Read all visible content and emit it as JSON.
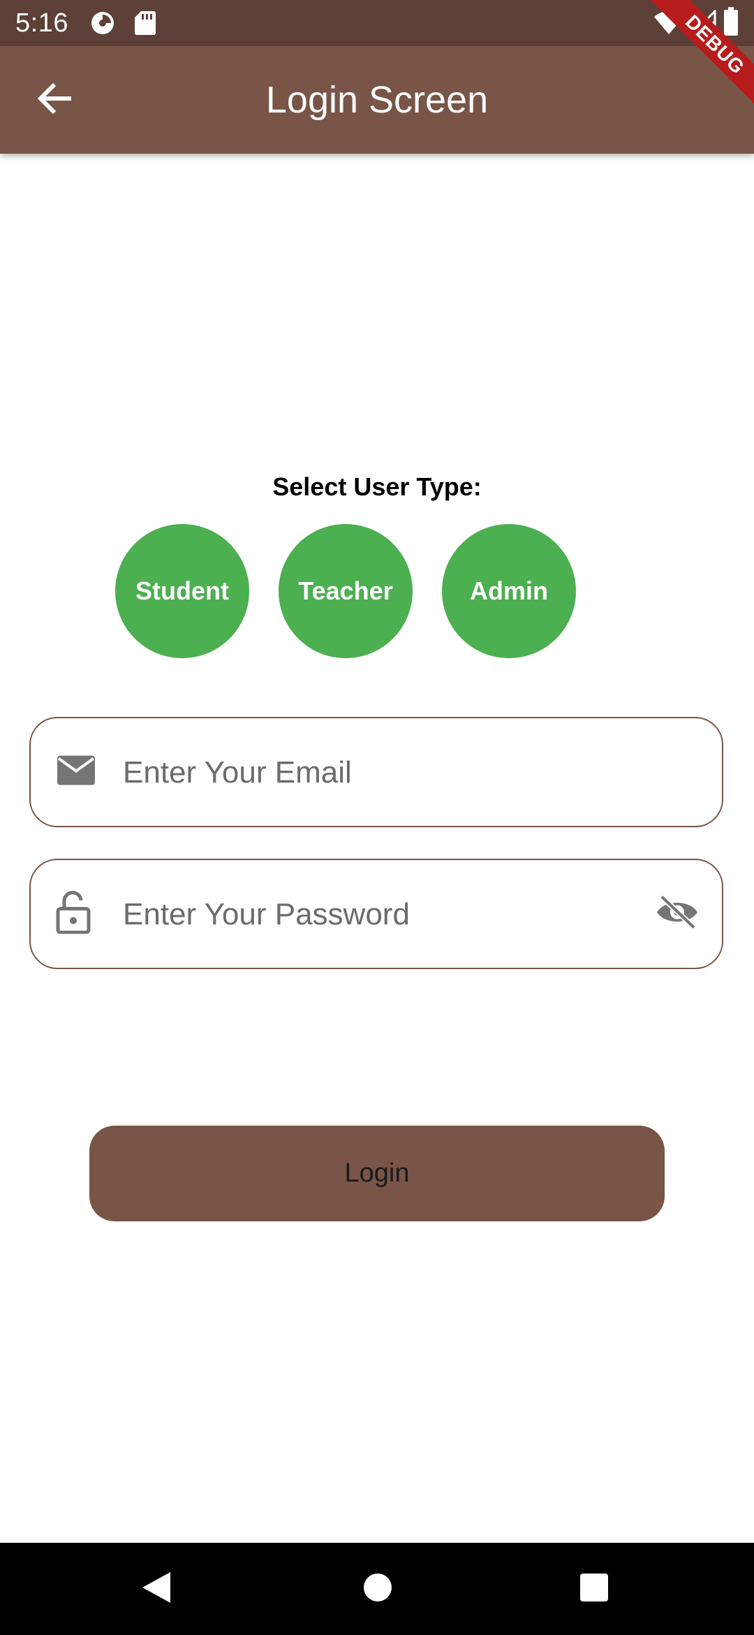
{
  "status_bar": {
    "time": "5:16"
  },
  "app_bar": {
    "title": "Login Screen",
    "debug_banner": "DEBUG"
  },
  "user_type": {
    "label": "Select User Type:",
    "options": [
      "Student",
      "Teacher",
      "Admin"
    ],
    "color": "#4caf50"
  },
  "email": {
    "placeholder": "Enter Your Email",
    "value": ""
  },
  "password": {
    "placeholder": "Enter Your Password",
    "value": ""
  },
  "login_button": {
    "label": "Login"
  },
  "colors": {
    "primary": "#795548",
    "status_bar": "#5d4037",
    "accent": "#4caf50"
  },
  "icons": {
    "back": "arrow-back-icon",
    "email": "mail-icon",
    "password": "lock-icon",
    "visibility": "visibility-off-icon"
  }
}
